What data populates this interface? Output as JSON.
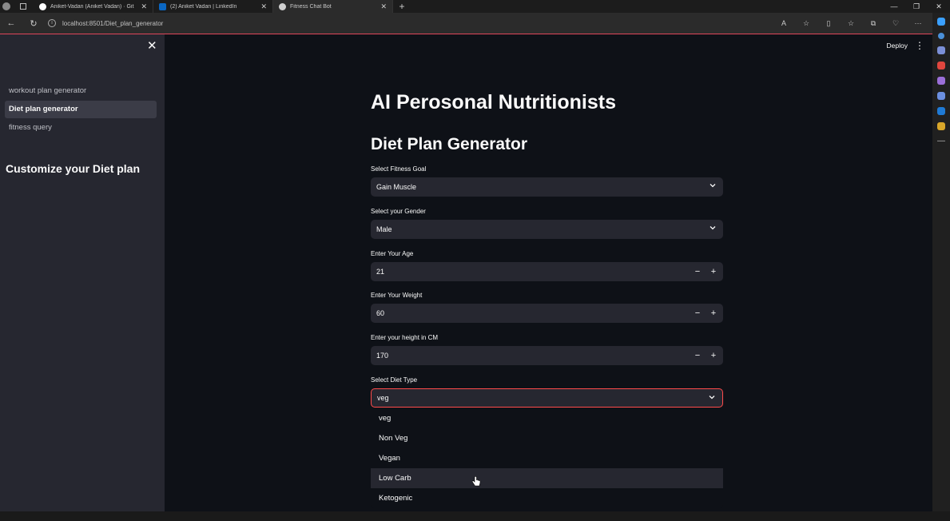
{
  "browser": {
    "tabs": [
      {
        "title": "Aniket-Vadan (Aniket Vadan) · Git",
        "favicon_color": "#ffffff",
        "active": false
      },
      {
        "title": "(2) Aniket Vadan | LinkedIn",
        "favicon_color": "#0a66c2",
        "active": false
      },
      {
        "title": "Fitness Chat Bot",
        "favicon_color": "#d0d0d0",
        "active": true
      }
    ],
    "new_tab": "+",
    "url": "localhost:8501/Diet_plan_generator",
    "window_controls": [
      "—",
      "❐",
      "✕"
    ]
  },
  "sidebar": {
    "close": "✕",
    "nav": [
      {
        "label": "workout plan generator",
        "active": false
      },
      {
        "label": "Diet plan generator",
        "active": true
      },
      {
        "label": "fitness query",
        "active": false
      }
    ],
    "heading": "Customize your Diet plan"
  },
  "header": {
    "deploy": "Deploy",
    "menu": "⋮"
  },
  "main": {
    "title": "AI Perosonal Nutritionists",
    "subtitle": "Diet Plan Generator",
    "fitness_goal": {
      "label": "Select Fitness Goal",
      "value": "Gain Muscle"
    },
    "gender": {
      "label": "Select your Gender",
      "value": "Male"
    },
    "age": {
      "label": "Enter Your Age",
      "value": "21"
    },
    "weight": {
      "label": "Enter Your Weight",
      "value": "60"
    },
    "height": {
      "label": "Enter your height in CM",
      "value": "170"
    },
    "diet_type": {
      "label": "Select Diet Type",
      "value": "veg",
      "options": [
        "veg",
        "Non Veg",
        "Vegan",
        "Low Carb",
        "Ketogenic"
      ],
      "hovered": "Low Carb"
    },
    "stepper_minus": "−",
    "stepper_plus": "+"
  },
  "colors": {
    "app_bg": "#0e1117",
    "sidebar_bg": "#262730",
    "input_bg": "#262730",
    "accent": "#ff4b4b"
  }
}
